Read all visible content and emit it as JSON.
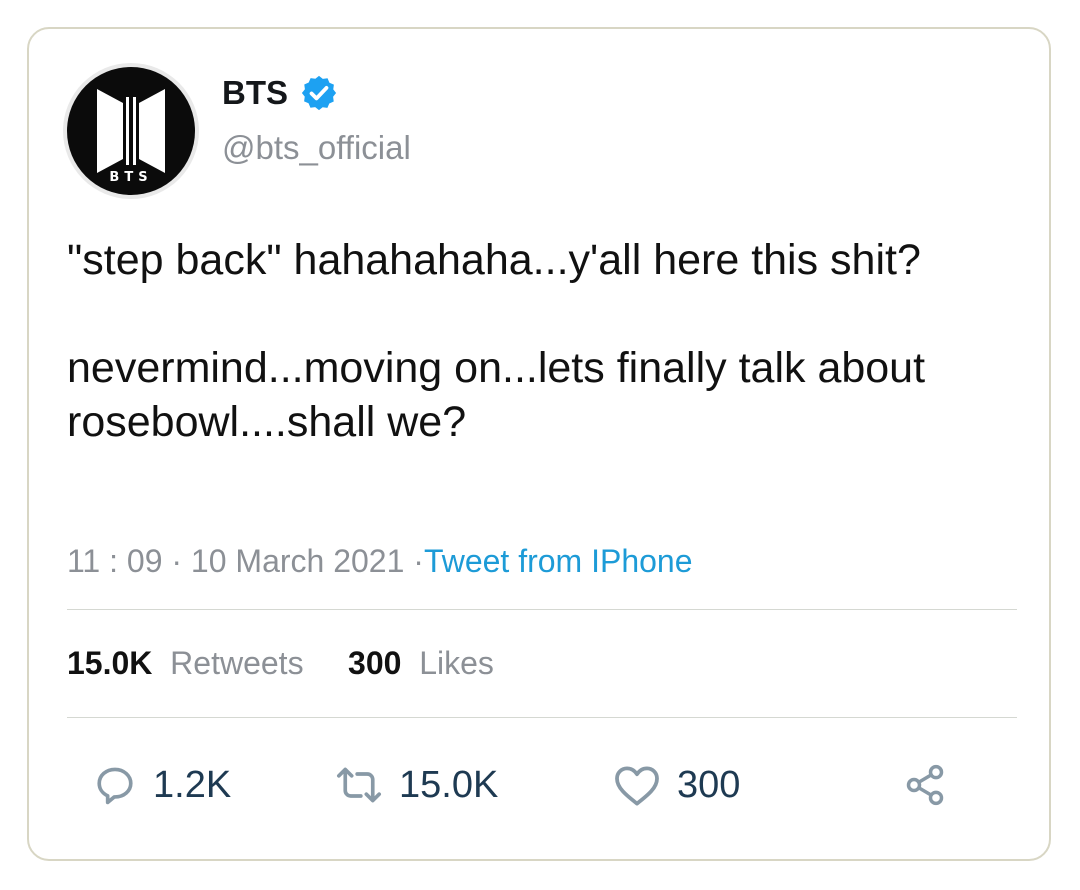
{
  "tweet": {
    "author": {
      "name": "BTS",
      "handle": "@bts_official",
      "verified": true,
      "avatar_logo_text": "BTS"
    },
    "text": "\"step back\" hahahahaha...y'all here this shit?\n\nnevermind...moving on...lets finally talk about rosebowl....shall we?",
    "timestamp": {
      "time": "11 : 09",
      "separator": " · ",
      "date": "10 March 2021",
      "source_prefix": " ·",
      "source": "Tweet from IPhone"
    },
    "stats": {
      "retweets_count": "15.0K",
      "retweets_label": "Retweets",
      "likes_count": "300",
      "likes_label": "Likes"
    },
    "actions": {
      "reply_count": "1.2K",
      "retweet_count": "15.0K",
      "like_count": "300"
    }
  },
  "icons": {
    "verified": "verified-badge-icon",
    "reply": "reply-icon",
    "retweet": "retweet-icon",
    "like": "heart-icon",
    "share": "share-icon"
  },
  "colors": {
    "verified_blue": "#1da1f2",
    "link_blue": "#1d9bd7",
    "muted_gray": "#8c9096",
    "action_gray": "#8899a6",
    "action_count": "#1e3a52",
    "card_border": "#d8d6c4"
  }
}
